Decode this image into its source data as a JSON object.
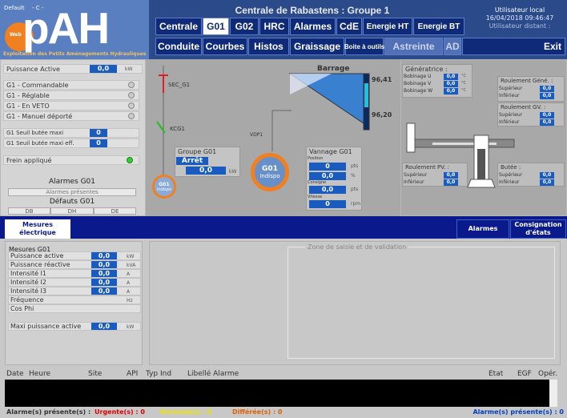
{
  "header": {
    "default_label": "Default",
    "default_sub": "- C -",
    "logo_text": "pAH",
    "logo_circle_text": "Web",
    "tagline": "Exploitation des Petits Aménagements Hydrauliques",
    "title": "Centrale de Rabastens : Groupe 1",
    "user_label": "Utilisateur  local",
    "datetime": "16/04/2018 09:46:47",
    "remote_label": "Utilisateur distant :"
  },
  "nav": {
    "row1": [
      "Centrale",
      "G01",
      "G02",
      "HRC",
      "Alarmes",
      "CdE",
      "Energie HT",
      "Energie BT"
    ],
    "row2": [
      "Conduite",
      "Courbes",
      "Histos",
      "Graissage",
      "Boite à outils",
      "Astreinte",
      "AD",
      "Exit"
    ]
  },
  "left": {
    "puissance_label": "Puissance Active",
    "puissance_val": "0,0",
    "puissance_unit": "kW",
    "modes": [
      "G1 - Commandable",
      "G1 - Réglable",
      "G1 - En VETO",
      "G1 - Manuel déporté"
    ],
    "seuil1": "G1 Seuil butée maxi",
    "seuil1_val": "0",
    "seuil2": "G1 Seuil butée maxi eff.",
    "seuil2_val": "0",
    "frein": "Frein appliqué",
    "alarmes_title": "Alarmes G01",
    "alarmes_present": "Alarmes présentes",
    "defauts_title": "Défauts G01",
    "defauts": [
      "DB",
      "DH",
      "DE"
    ]
  },
  "mid": {
    "sec": "SEC_G1",
    "kcg": "KCG1",
    "vdp": "VDP1",
    "groupe_title": "Groupe G01",
    "groupe_state": "Arrêt",
    "groupe_val": "0,0",
    "groupe_unit": "kW",
    "g01": "G01",
    "g01_state": "Indispo",
    "barrage": "Barrage",
    "lvl_hi": "96,41",
    "lvl_lo": "96,20",
    "vannage_title": "Vannage G01",
    "position": "Position",
    "pos_val": "0",
    "pos_unit": "pts",
    "pct_val": "0,0",
    "pct_unit": "%",
    "consigne": "Consigne",
    "cons_val": "0,0",
    "cons_unit": "pts",
    "vitesse": "Vitesse",
    "vit_val": "0",
    "vit_unit": "rpm",
    "small_label": "G01",
    "small_state": "Indispo"
  },
  "right": {
    "gen_title": "Génératrice :",
    "bob": [
      "Bobinage U",
      "Bobinage V",
      "Bobinage W"
    ],
    "bob_val": "0,0",
    "deg": "°C",
    "roul_gen": "Roulement Géné. :",
    "roul_gv": "Roulement GV. :",
    "roul_pv": "Roulement PV. :",
    "butee": "Butée :",
    "sup": "Supérieur",
    "inf": "Inférieur",
    "val": "0,0"
  },
  "tabs": {
    "mesures": "Mesures électrique",
    "alarmes": "Alarmes",
    "consignation": "Consignation d'états"
  },
  "mesures": {
    "title": "Mesures G01",
    "rows": [
      {
        "l": "Puissance active",
        "v": "0,0",
        "u": "kW"
      },
      {
        "l": "Puissance réactive",
        "v": "0,0",
        "u": "kVA"
      },
      {
        "l": "Intensité I1",
        "v": "0,0",
        "u": "A"
      },
      {
        "l": "Intensité I2",
        "v": "0,0",
        "u": "A"
      },
      {
        "l": "Intensité I3",
        "v": "0,0",
        "u": "A"
      },
      {
        "l": "Fréquence",
        "v": "",
        "u": "Hz"
      },
      {
        "l": "Cos Phi",
        "v": "",
        "u": ""
      }
    ],
    "maxi": "Maxi puissance active",
    "maxi_val": "0,0",
    "maxi_unit": "kW"
  },
  "zone": {
    "title": "Zone de saisie et de validation"
  },
  "alarm_cols": [
    "Date",
    "Heure",
    "Site",
    "API",
    "Typ Ind",
    "Libellé Alarme",
    "Etat",
    "EGF",
    "Opér."
  ],
  "status": {
    "present": "Alarme(s) présente(s) :",
    "urgente": "Urgente(s) : 0",
    "normale": "Normale(s) : 0",
    "differee": "Différée(s) : 0",
    "right": "Alarme(s) présente(s) : 0"
  },
  "colors": {
    "urgent": "#e00000",
    "normal": "#f0e000",
    "differee": "#e06000",
    "right": "#0040c0"
  }
}
